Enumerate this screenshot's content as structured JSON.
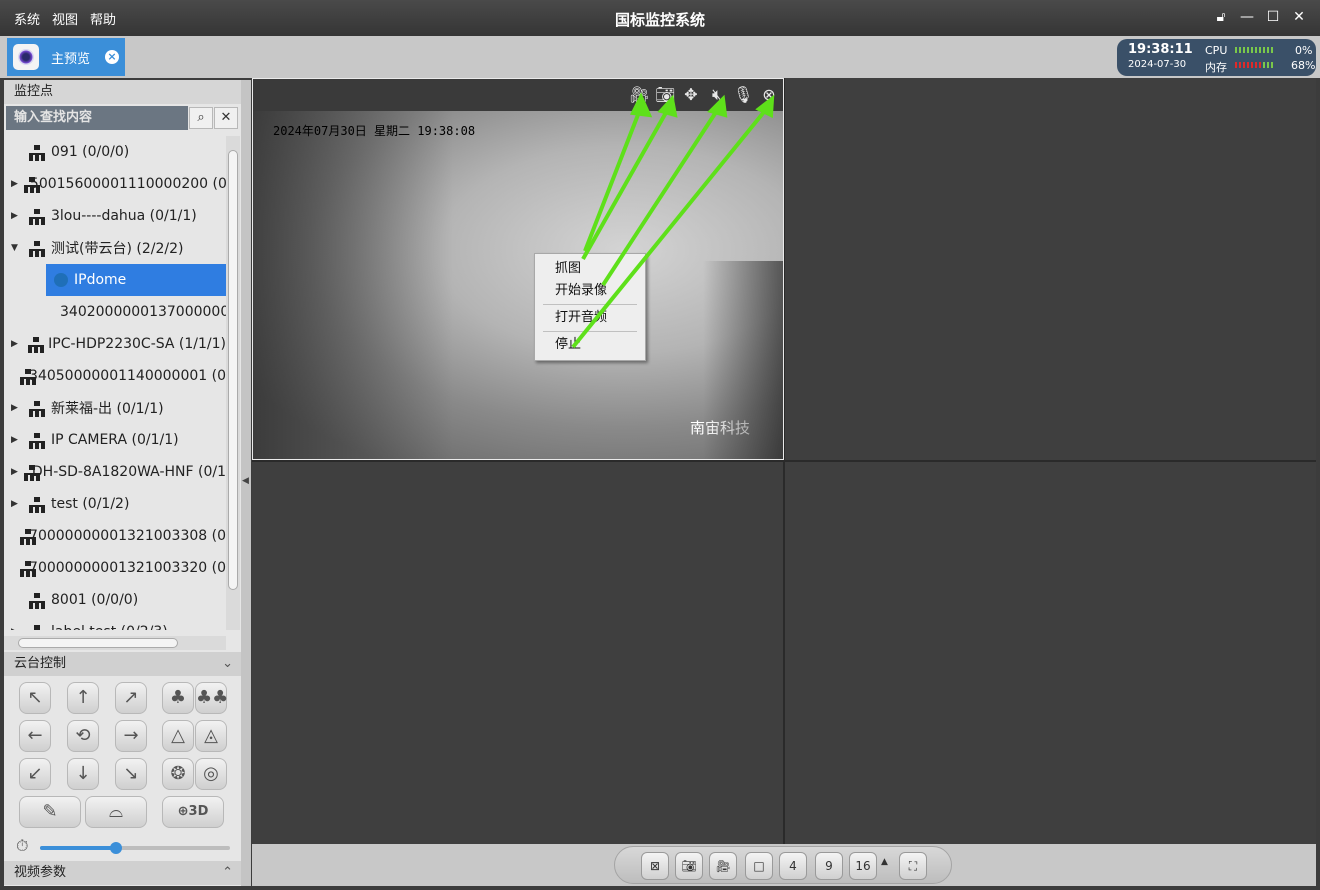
{
  "menu": {
    "items": [
      "系统",
      "视图",
      "帮助"
    ]
  },
  "app_title": "国标监控系统",
  "tab": {
    "label": "主预览",
    "close": "×"
  },
  "status": {
    "time": "19:38:11",
    "date": "2024-07-30",
    "cpu_label": "CPU",
    "cpu_value": "0%",
    "mem_label": "内存",
    "mem_value": "68%"
  },
  "left": {
    "monitor_header": "监控点",
    "search_placeholder": "输入查找内容",
    "tree": [
      {
        "label": "091 (0/0/0)",
        "arrow": "",
        "type": "org"
      },
      {
        "label": "50015600001110000200 (0",
        "arrow": "▶",
        "type": "org"
      },
      {
        "label": "3lou----dahua (0/1/1)",
        "arrow": "▶",
        "type": "org"
      },
      {
        "label": "测试(带云台) (2/2/2)",
        "arrow": "▼",
        "type": "org"
      },
      {
        "label": "IPdome",
        "arrow": "",
        "type": "cam-selected"
      },
      {
        "label": "34020000001370000000",
        "arrow": "",
        "type": "cam"
      },
      {
        "label": "IPC-HDP2230C-SA (1/1/1)",
        "arrow": "▶",
        "type": "org"
      },
      {
        "label": "34050000001140000001 (0",
        "arrow": "",
        "type": "org"
      },
      {
        "label": "新莱福-出 (0/1/1)",
        "arrow": "▶",
        "type": "org"
      },
      {
        "label": "IP CAMERA (0/1/1)",
        "arrow": "▶",
        "type": "org"
      },
      {
        "label": "DH-SD-8A1820WA-HNF (0/1",
        "arrow": "▶",
        "type": "org"
      },
      {
        "label": "test (0/1/2)",
        "arrow": "▶",
        "type": "org"
      },
      {
        "label": "70000000001321003308 (0",
        "arrow": "",
        "type": "org"
      },
      {
        "label": "70000000001321003320 (0",
        "arrow": "",
        "type": "org"
      },
      {
        "label": "8001 (0/0/0)",
        "arrow": "",
        "type": "org"
      },
      {
        "label": "label test (0/2/3)",
        "arrow": "▶",
        "type": "org"
      }
    ],
    "ptz_header": "云台控制",
    "ptz_buttons": [
      "↖",
      "↑",
      "↗",
      "←",
      "⟲",
      "→",
      "↙",
      "↓",
      "↘"
    ],
    "speed_value": 0.4,
    "video_params_header": "视频参数"
  },
  "video": {
    "osd_timestamp": "2024年07月30日  星期二  19:38:08",
    "watermark": "南宙科技",
    "context_menu": [
      "抓图",
      "开始录像",
      "打开音频",
      "停止"
    ]
  },
  "bottom": {
    "layout_labels": [
      "4",
      "9",
      "16"
    ]
  },
  "colors": {
    "accent": "#3b8fd9",
    "selected": "#2f7de1",
    "annotation": "#5ee01a"
  }
}
